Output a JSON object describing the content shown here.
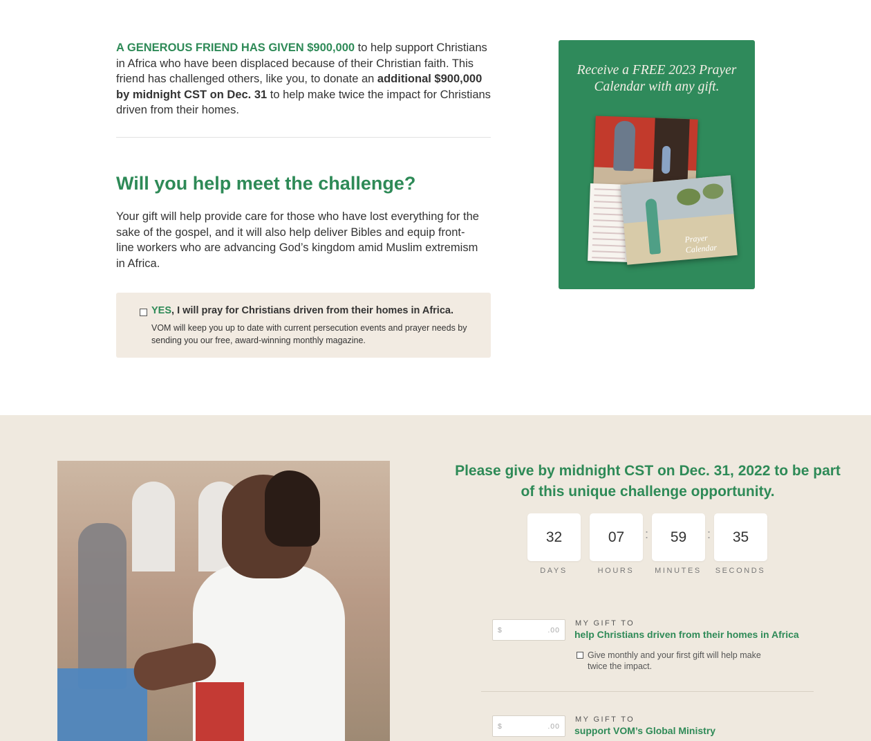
{
  "intro": {
    "highlight": "A GENEROUS FRIEND HAS GIVEN $900,000",
    "text_a": " to help support Christians in Africa who have been displaced because of their Christian faith. This friend has challenged others, like you, to donate an ",
    "bold": "additional $900,000 by midnight CST on Dec. 31",
    "text_b": " to help make twice the impact for Christians driven from their homes."
  },
  "challenge": {
    "title": "Will you help meet the challenge?",
    "body": "Your gift will help provide care for those who have lost everything for the sake of the gospel, and it will also help deliver Bibles and equip front-line workers who are advancing God’s kingdom amid Muslim extremism in Africa."
  },
  "pray_option": {
    "yes": "YES",
    "label": ", I will pray for Christians driven from their homes in Africa.",
    "description": "VOM will keep you up to date with current persecution events and prayer needs by sending you our free, award-winning monthly magazine.",
    "checked": false
  },
  "promo": {
    "text": "Receive a FREE 2023 Prayer Calendar with any gift.",
    "calendar_label": "Prayer Calendar",
    "bg_color": "#2f8a5b"
  },
  "deadline": {
    "message": "Please give by midnight CST on Dec. 31, 2022 to be part of this unique challenge opportunity."
  },
  "countdown": {
    "separator": ":",
    "units": [
      {
        "value": "32",
        "label": "DAYS"
      },
      {
        "value": "07",
        "label": "HOURS"
      },
      {
        "value": "59",
        "label": "MINUTES"
      },
      {
        "value": "35",
        "label": "SECONDS"
      }
    ]
  },
  "gifts": [
    {
      "currency": "$",
      "cents": ".00",
      "value": "",
      "label": "MY GIFT TO",
      "target": "help Christians driven from their homes in Africa",
      "monthly_label": "Give monthly and your first gift will help make twice the impact.",
      "monthly_checked": false
    },
    {
      "currency": "$",
      "cents": ".00",
      "value": "",
      "label": "MY GIFT TO",
      "target": "support VOM’s Global Ministry"
    }
  ],
  "colors": {
    "accent_green": "#2e8a57",
    "promo_green": "#2f8a5b",
    "pray_box_bg": "#f2ebe2",
    "section_bg": "#efe9df"
  }
}
